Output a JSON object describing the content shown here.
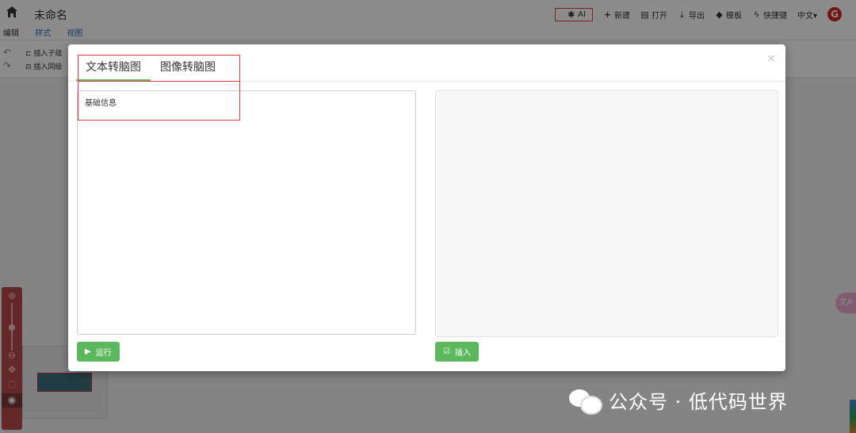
{
  "app": {
    "doc_title": "未命名",
    "menu_tabs": [
      "编辑",
      "样式",
      "视图"
    ]
  },
  "header": {
    "actions": [
      {
        "label": "AI",
        "icon": "gear-icon"
      },
      {
        "label": "新建",
        "icon": "plus-icon"
      },
      {
        "label": "打开",
        "icon": "open-icon"
      },
      {
        "label": "导出",
        "icon": "download-icon"
      },
      {
        "label": "模板",
        "icon": "tag-icon"
      },
      {
        "label": "快捷键",
        "icon": "bolt-icon"
      }
    ],
    "language": "中文▾",
    "logo_letter": "G"
  },
  "toolbar": {
    "insert_child": "插入子级",
    "insert_sibling": "插入同级"
  },
  "modal": {
    "tabs": [
      "文本转脑图",
      "图像转脑图"
    ],
    "active_tab": 0,
    "close_symbol": "×",
    "input_text": "基础信息",
    "run_label": "运行",
    "insert_label": "插入"
  },
  "side": {
    "translate_icon_label": "文A"
  },
  "watermark": {
    "text": "公众号 · 低代码世界"
  },
  "colors": {
    "accent_green": "#5cb85c",
    "highlight_red": "#e23a3a",
    "zoom_panel": "#b74a4a"
  }
}
